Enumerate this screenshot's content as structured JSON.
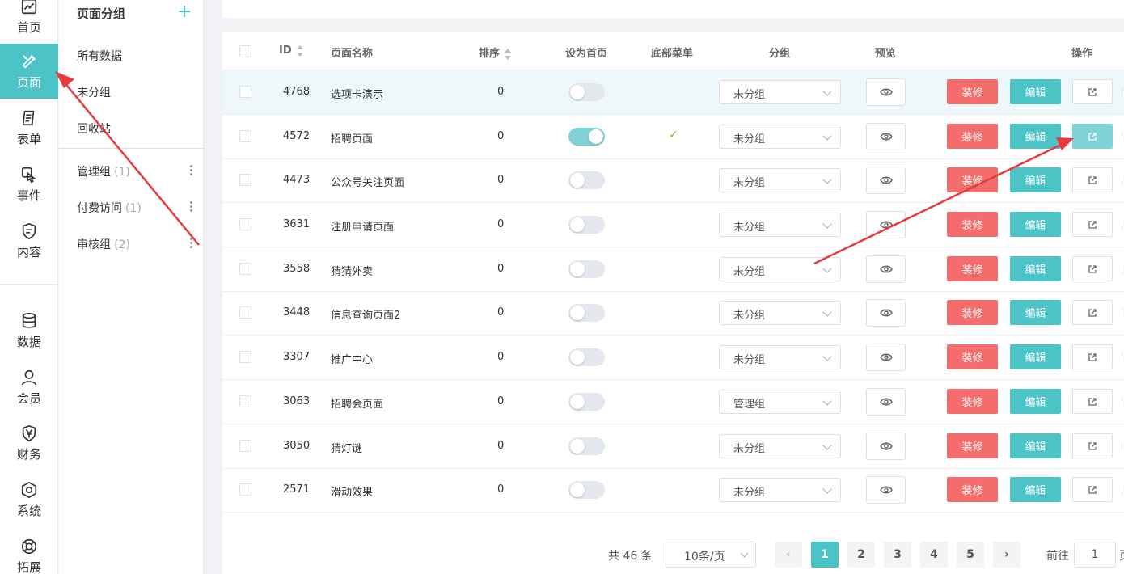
{
  "nav": {
    "items": [
      {
        "label": "首页",
        "icon": "chart-icon"
      },
      {
        "label": "页面",
        "icon": "pen-ruler-icon",
        "active": true
      },
      {
        "label": "表单",
        "icon": "form-icon"
      },
      {
        "label": "事件",
        "icon": "hand-pointer-icon"
      },
      {
        "label": "内容",
        "icon": "shield-doc-icon"
      },
      {
        "label": "数据",
        "icon": "database-icon"
      },
      {
        "label": "会员",
        "icon": "user-icon"
      },
      {
        "label": "财务",
        "icon": "yen-shield-icon"
      },
      {
        "label": "系统",
        "icon": "gear-hex-icon"
      },
      {
        "label": "拓展",
        "icon": "lifebuoy-icon"
      }
    ]
  },
  "groups": {
    "title": "页面分组",
    "add": "+",
    "links": [
      "所有数据",
      "未分组",
      "回收站"
    ],
    "items": [
      {
        "name": "管理组",
        "count": "(1)"
      },
      {
        "name": "付费访问",
        "count": "(1)"
      },
      {
        "name": "审核组",
        "count": "(2)"
      }
    ]
  },
  "table": {
    "headers": {
      "id": "ID",
      "name": "页面名称",
      "sort": "排序",
      "home": "设为首页",
      "bottom": "底部菜单",
      "group": "分组",
      "preview": "预览",
      "ops": "操作"
    },
    "decorate_label": "装修",
    "edit_label": "编辑",
    "bottom_check": "✓",
    "rows": [
      {
        "id": "4768",
        "name": "选项卡演示",
        "sort": "0",
        "home": false,
        "group": "未分组"
      },
      {
        "id": "4572",
        "name": "招聘页面",
        "sort": "0",
        "home": true,
        "group": "未分组"
      },
      {
        "id": "4473",
        "name": "公众号关注页面",
        "sort": "0",
        "home": false,
        "group": "未分组"
      },
      {
        "id": "3631",
        "name": "注册申请页面",
        "sort": "0",
        "home": false,
        "group": "未分组"
      },
      {
        "id": "3558",
        "name": "猜猜外卖",
        "sort": "0",
        "home": false,
        "group": "未分组"
      },
      {
        "id": "3448",
        "name": "信息查询页面2",
        "sort": "0",
        "home": false,
        "group": "未分组"
      },
      {
        "id": "3307",
        "name": "推广中心",
        "sort": "0",
        "home": false,
        "group": "未分组"
      },
      {
        "id": "3063",
        "name": "招聘会页面",
        "sort": "0",
        "home": false,
        "group": "管理组"
      },
      {
        "id": "3050",
        "name": "猜灯谜",
        "sort": "0",
        "home": false,
        "group": "未分组"
      },
      {
        "id": "2571",
        "name": "滑动效果",
        "sort": "0",
        "home": false,
        "group": "未分组"
      }
    ]
  },
  "pagination": {
    "total": "共 46 条",
    "page_size": "10条/页",
    "prev": "‹",
    "next": "›",
    "pages": [
      "1",
      "2",
      "3",
      "4",
      "5"
    ],
    "current": "1",
    "goto_label": "前往",
    "goto_value": "1",
    "goto_tail": "页"
  },
  "colors": {
    "accent": "#4cc3c7",
    "danger": "#f56c6c",
    "annotation": "#e83a3a"
  }
}
